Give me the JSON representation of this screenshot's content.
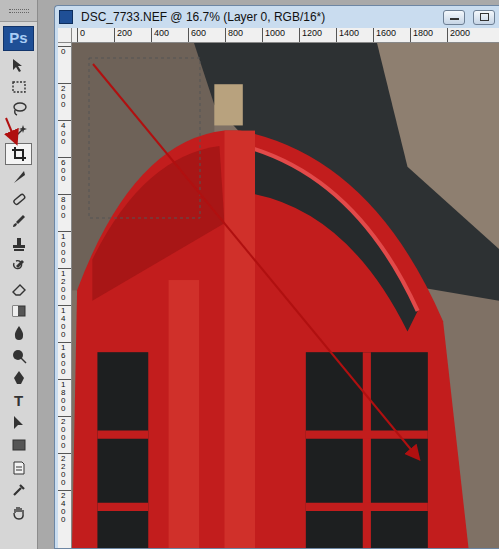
{
  "app": {
    "logo": "Ps"
  },
  "tools": [
    {
      "selected": false
    },
    {
      "selected": false
    },
    {
      "selected": false
    },
    {
      "selected": false
    },
    {
      "selected": true
    },
    {
      "selected": false
    },
    {
      "selected": false
    },
    {
      "selected": false
    },
    {
      "selected": false
    },
    {
      "selected": false
    },
    {
      "selected": false
    },
    {
      "selected": false
    },
    {
      "selected": false
    },
    {
      "selected": false
    },
    {
      "selected": false
    },
    {
      "selected": false,
      "glyph": "T"
    },
    {
      "selected": false
    },
    {
      "selected": false
    },
    {
      "selected": false
    },
    {
      "selected": false
    },
    {
      "selected": false
    }
  ],
  "window": {
    "title": "DSC_7733.NEF @ 16.7% (Layer 0, RGB/16*)"
  },
  "rulers": {
    "horizontal": [
      "0",
      "200",
      "400",
      "600",
      "800",
      "1000",
      "1200",
      "1400",
      "1600",
      "1800",
      "2000"
    ],
    "vertical": [
      "0",
      "200",
      "400",
      "600",
      "800",
      "1000",
      "1200",
      "1400",
      "1600",
      "1800",
      "2000",
      "2200",
      "2400"
    ]
  }
}
